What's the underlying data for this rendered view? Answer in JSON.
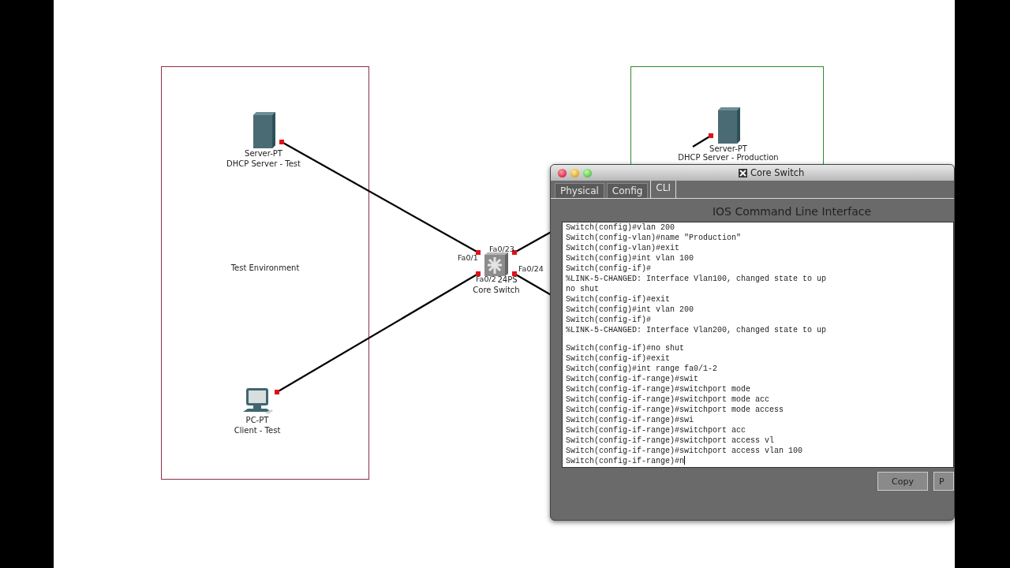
{
  "canvas": {
    "areas": [
      {
        "label": "Test Environment",
        "color": "#8c2f45"
      },
      {
        "color": "#2e8b2e"
      }
    ],
    "devices": [
      {
        "kind": "server",
        "model": "Server-PT",
        "name": "DHCP Server - Test"
      },
      {
        "kind": "pc",
        "model": "PC-PT",
        "name": "Client - Test"
      },
      {
        "kind": "switch",
        "model": "24PS",
        "name": "Core Switch"
      },
      {
        "kind": "server",
        "model": "Server-PT",
        "name": "DHCP Server - Production"
      }
    ],
    "port_labels": [
      "Fa0/1",
      "Fa0/23",
      "Fa0/24",
      "Fa0/2"
    ]
  },
  "window": {
    "title": "Core Switch",
    "tabs": [
      {
        "label": "Physical",
        "selected": false
      },
      {
        "label": "Config",
        "selected": false
      },
      {
        "label": "CLI",
        "selected": true
      }
    ],
    "heading": "IOS Command Line Interface",
    "cli_lines": [
      {
        "kind": "line",
        "text": "Switch(config)#vlan 200"
      },
      {
        "kind": "line",
        "text": "Switch(config-vlan)#name \"Production\""
      },
      {
        "kind": "line",
        "text": "Switch(config-vlan)#exit"
      },
      {
        "kind": "line",
        "text": "Switch(config)#int vlan 100"
      },
      {
        "kind": "line",
        "text": "Switch(config-if)#"
      },
      {
        "kind": "line",
        "text": "%LINK-5-CHANGED: Interface Vlan100, changed state to up"
      },
      {
        "kind": "line",
        "text": "no shut"
      },
      {
        "kind": "line",
        "text": "Switch(config-if)#exit"
      },
      {
        "kind": "line",
        "text": "Switch(config)#int vlan 200"
      },
      {
        "kind": "line",
        "text": "Switch(config-if)#"
      },
      {
        "kind": "line",
        "text": "%LINK-5-CHANGED: Interface Vlan200, changed state to up"
      },
      {
        "kind": "blank"
      },
      {
        "kind": "line",
        "text": "Switch(config-if)#no shut"
      },
      {
        "kind": "line",
        "text": "Switch(config-if)#exit"
      },
      {
        "kind": "line",
        "text": "Switch(config)#int range fa0/1-2"
      },
      {
        "kind": "line",
        "text": "Switch(config-if-range)#swit"
      },
      {
        "kind": "line",
        "text": "Switch(config-if-range)#switchport mode"
      },
      {
        "kind": "line",
        "text": "Switch(config-if-range)#switchport mode acc"
      },
      {
        "kind": "line",
        "text": "Switch(config-if-range)#switchport mode access"
      },
      {
        "kind": "line",
        "text": "Switch(config-if-range)#swi"
      },
      {
        "kind": "line",
        "text": "Switch(config-if-range)#switchport acc"
      },
      {
        "kind": "line",
        "text": "Switch(config-if-range)#switchport access vl"
      },
      {
        "kind": "line",
        "text": "Switch(config-if-range)#switchport access vlan 100"
      },
      {
        "kind": "input",
        "text": "Switch(config-if-range)#n"
      }
    ],
    "buttons": [
      "Copy",
      "P"
    ]
  }
}
